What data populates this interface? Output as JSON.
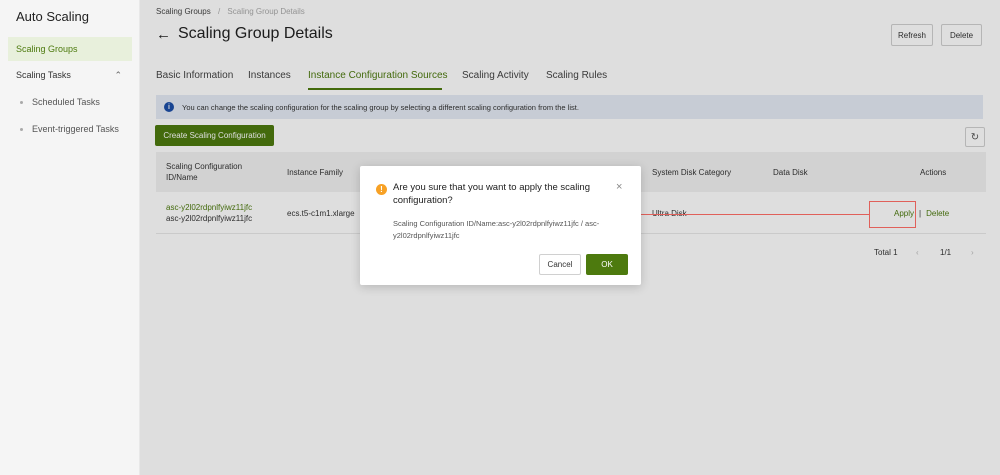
{
  "sidebar": {
    "app_title": "Auto Scaling",
    "items": [
      {
        "label": "Scaling Groups"
      },
      {
        "label": "Scaling Tasks"
      }
    ],
    "sub_items": [
      {
        "label": "Scheduled Tasks"
      },
      {
        "label": "Event-triggered Tasks"
      }
    ]
  },
  "breadcrumb": {
    "root": "Scaling Groups",
    "separator": "/",
    "current": "Scaling Group Details"
  },
  "header": {
    "title": "Scaling Group Details",
    "refresh_label": "Refresh",
    "delete_label": "Delete"
  },
  "tabs": [
    {
      "label": "Basic Information"
    },
    {
      "label": "Instances"
    },
    {
      "label": "Instance Configuration Sources"
    },
    {
      "label": "Scaling Activity"
    },
    {
      "label": "Scaling Rules"
    }
  ],
  "banner": {
    "text": "You can change the scaling configuration for the scaling group by selecting a different scaling configuration from the list."
  },
  "toolbar": {
    "create_label": "Create Scaling Configuration"
  },
  "table": {
    "headers": {
      "id_line1": "Scaling Configuration",
      "id_line2": "ID/Name",
      "family": "Instance Family",
      "disk_category": "System Disk Category",
      "data_disk": "Data Disk",
      "actions": "Actions"
    },
    "rows": [
      {
        "id": "asc-y2l02rdpnlfyiwz11jfc",
        "name": "asc-y2l02rdpnlfyiwz11jfc",
        "family": "ecs.t5-c1m1.xlarge",
        "disk_category": "Ultra Disk",
        "apply_label": "Apply",
        "action_sep": "|",
        "delete_label": "Delete"
      }
    ]
  },
  "pagination": {
    "total": "Total 1",
    "page": "1/1"
  },
  "modal": {
    "title": "Are you sure that you want to apply the scaling configuration?",
    "body": "Scaling Configuration ID/Name:asc-y2l02rdpnlfyiwz11jfc / asc-y2l02rdpnlfyiwz11jfc",
    "cancel_label": "Cancel",
    "ok_label": "OK"
  },
  "colors": {
    "accent": "#4d7a0e",
    "banner_bg": "#e5ebf5",
    "warning": "#f7a125",
    "annotation": "#e0605a"
  }
}
